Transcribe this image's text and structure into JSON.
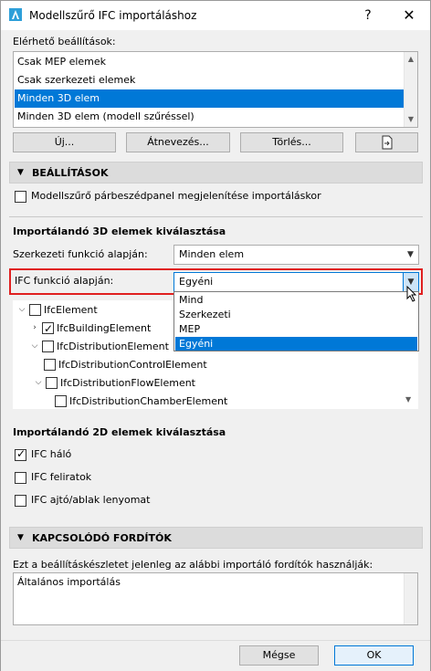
{
  "window": {
    "title": "Modellszűrő IFC importáláshoz",
    "help": "?",
    "close": "✕"
  },
  "presets": {
    "label": "Elérhető beállítások:",
    "items": [
      {
        "label": "Csak MEP elemek"
      },
      {
        "label": "Csak szerkezeti elemek"
      },
      {
        "label": "Minden 3D elem"
      },
      {
        "label": "Minden 3D elem (modell szűréssel)"
      }
    ],
    "selected_index": 2
  },
  "buttons": {
    "new": "Új...",
    "rename": "Átnevezés...",
    "delete": "Törlés..."
  },
  "settings_section": {
    "title": "BEÁLLÍTÁSOK",
    "show_dialog_label": "Modellszűrő párbeszédpanel megjelenítése importáláskor",
    "show_dialog_checked": false
  },
  "elements_3d": {
    "title": "Importálandó 3D elemek kiválasztása",
    "structural_label": "Szerkezeti funkció alapján:",
    "structural_value": "Minden elem",
    "ifc_function_label": "IFC funkció alapján:",
    "ifc_function_value": "Egyéni",
    "ifc_function_options": [
      "Mind",
      "Szerkezeti",
      "MEP",
      "Egyéni"
    ],
    "ifc_function_selected": 3
  },
  "tree": [
    {
      "label": "IfcElement",
      "expanded": true,
      "checked": false
    },
    {
      "label": "IfcBuildingElement",
      "expanded": false,
      "checked": true
    },
    {
      "label": "IfcDistributionElement",
      "expanded": true,
      "checked": false
    },
    {
      "label": "IfcDistributionControlElement",
      "checked": false
    },
    {
      "label": "IfcDistributionFlowElement",
      "expanded": true,
      "checked": false
    },
    {
      "label": "IfcDistributionChamberElement",
      "checked": false
    }
  ],
  "elements_2d": {
    "title": "Importálandó 2D elemek kiválasztása",
    "items": [
      {
        "label": "IFC háló",
        "checked": true
      },
      {
        "label": "IFC feliratok",
        "checked": false
      },
      {
        "label": "IFC ajtó/ablak lenyomat",
        "checked": false
      }
    ]
  },
  "translators_section": {
    "title": "KAPCSOLÓDÓ FORDÍTÓK",
    "description": "Ezt a beállításkészletet jelenleg az alábbi importáló fordítók használják:",
    "translators": "Általános importálás"
  },
  "footer": {
    "cancel": "Mégse",
    "ok": "OK"
  },
  "colors": {
    "selection": "#0078d7",
    "highlight_border": "#e02020",
    "section_bg": "#dcdcdc"
  }
}
